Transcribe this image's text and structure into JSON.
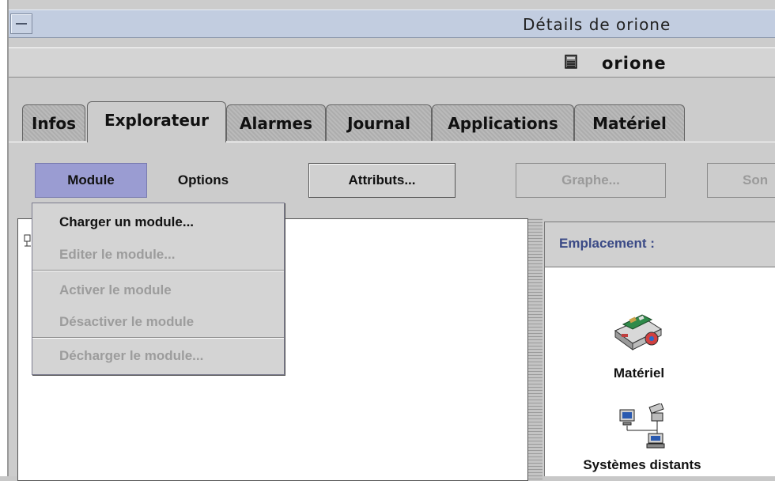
{
  "window": {
    "title": "Détails de orione",
    "host": "orione"
  },
  "tabs": [
    {
      "label": "Infos",
      "active": false
    },
    {
      "label": "Explorateur",
      "active": true
    },
    {
      "label": "Alarmes",
      "active": false
    },
    {
      "label": "Journal",
      "active": false
    },
    {
      "label": "Applications",
      "active": false
    },
    {
      "label": "Matériel",
      "active": false
    }
  ],
  "toolbar": {
    "module_label": "Module",
    "options_label": "Options",
    "attributs_label": "Attributs...",
    "graphe_label": "Graphe...",
    "son_label": "Son"
  },
  "module_menu": {
    "items": [
      {
        "label": "Charger un module...",
        "enabled": true
      },
      {
        "label": "Editer le module...",
        "enabled": false
      },
      {
        "label": "Activer le module",
        "enabled": false
      },
      {
        "label": "Désactiver le module",
        "enabled": false
      },
      {
        "label": "Décharger le module...",
        "enabled": false
      }
    ]
  },
  "location": {
    "label": "Emplacement :"
  },
  "content_items": [
    {
      "label": "Matériel",
      "icon": "hardware-icon"
    },
    {
      "label": "Systèmes distants",
      "icon": "remote-systems-icon"
    }
  ],
  "colors": {
    "title_bar": "#c2cde0",
    "menu_highlight": "#9a9cd2",
    "location_text": "#3b4a86",
    "disabled_text": "#9c9c9c"
  }
}
